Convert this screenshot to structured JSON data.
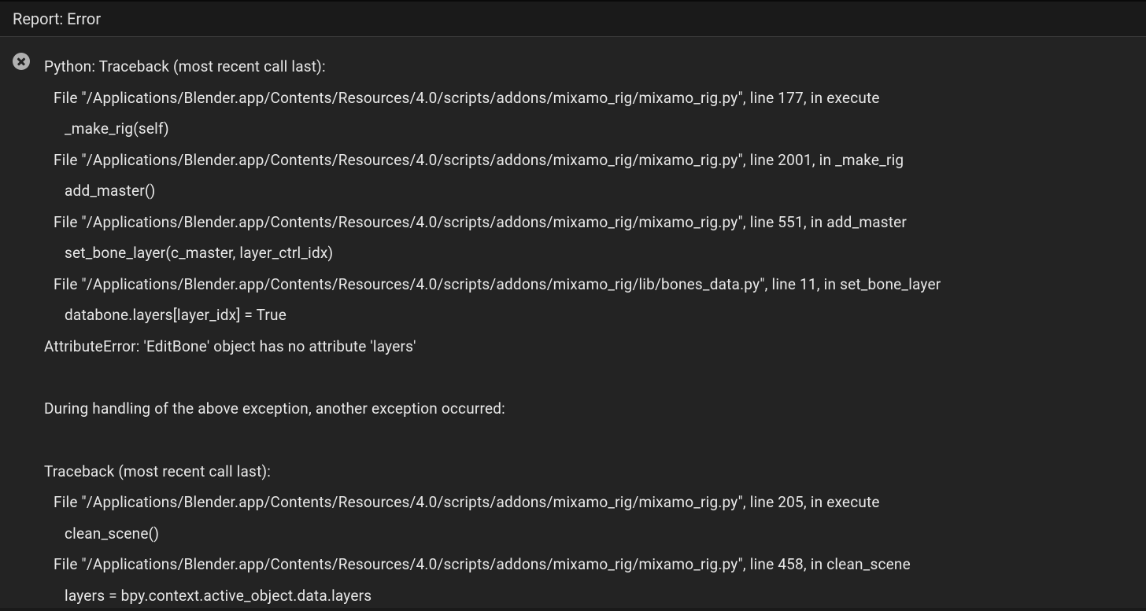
{
  "header": {
    "title": "Report: Error"
  },
  "error": {
    "lines": [
      {
        "indent": 0,
        "text": "Python: Traceback (most recent call last):"
      },
      {
        "indent": 1,
        "text": "File \"/Applications/Blender.app/Contents/Resources/4.0/scripts/addons/mixamo_rig/mixamo_rig.py\", line 177, in execute"
      },
      {
        "indent": 2,
        "text": "_make_rig(self)"
      },
      {
        "indent": 1,
        "text": "File \"/Applications/Blender.app/Contents/Resources/4.0/scripts/addons/mixamo_rig/mixamo_rig.py\", line 2001, in _make_rig"
      },
      {
        "indent": 2,
        "text": "add_master()"
      },
      {
        "indent": 1,
        "text": "File \"/Applications/Blender.app/Contents/Resources/4.0/scripts/addons/mixamo_rig/mixamo_rig.py\", line 551, in add_master"
      },
      {
        "indent": 2,
        "text": "set_bone_layer(c_master, layer_ctrl_idx)"
      },
      {
        "indent": 1,
        "text": "File \"/Applications/Blender.app/Contents/Resources/4.0/scripts/addons/mixamo_rig/lib/bones_data.py\", line 11, in set_bone_layer"
      },
      {
        "indent": 2,
        "text": "databone.layers[layer_idx] = True"
      },
      {
        "indent": 0,
        "text": "AttributeError: 'EditBone' object has no attribute 'layers'"
      },
      {
        "indent": 0,
        "text": "",
        "blank": true
      },
      {
        "indent": 0,
        "text": "During handling of the above exception, another exception occurred:"
      },
      {
        "indent": 0,
        "text": "",
        "blank": true
      },
      {
        "indent": 0,
        "text": "Traceback (most recent call last):"
      },
      {
        "indent": 1,
        "text": "File \"/Applications/Blender.app/Contents/Resources/4.0/scripts/addons/mixamo_rig/mixamo_rig.py\", line 205, in execute"
      },
      {
        "indent": 2,
        "text": "clean_scene()"
      },
      {
        "indent": 1,
        "text": "File \"/Applications/Blender.app/Contents/Resources/4.0/scripts/addons/mixamo_rig/mixamo_rig.py\", line 458, in clean_scene"
      },
      {
        "indent": 2,
        "text": "layers = bpy.context.active_object.data.layers"
      }
    ]
  }
}
